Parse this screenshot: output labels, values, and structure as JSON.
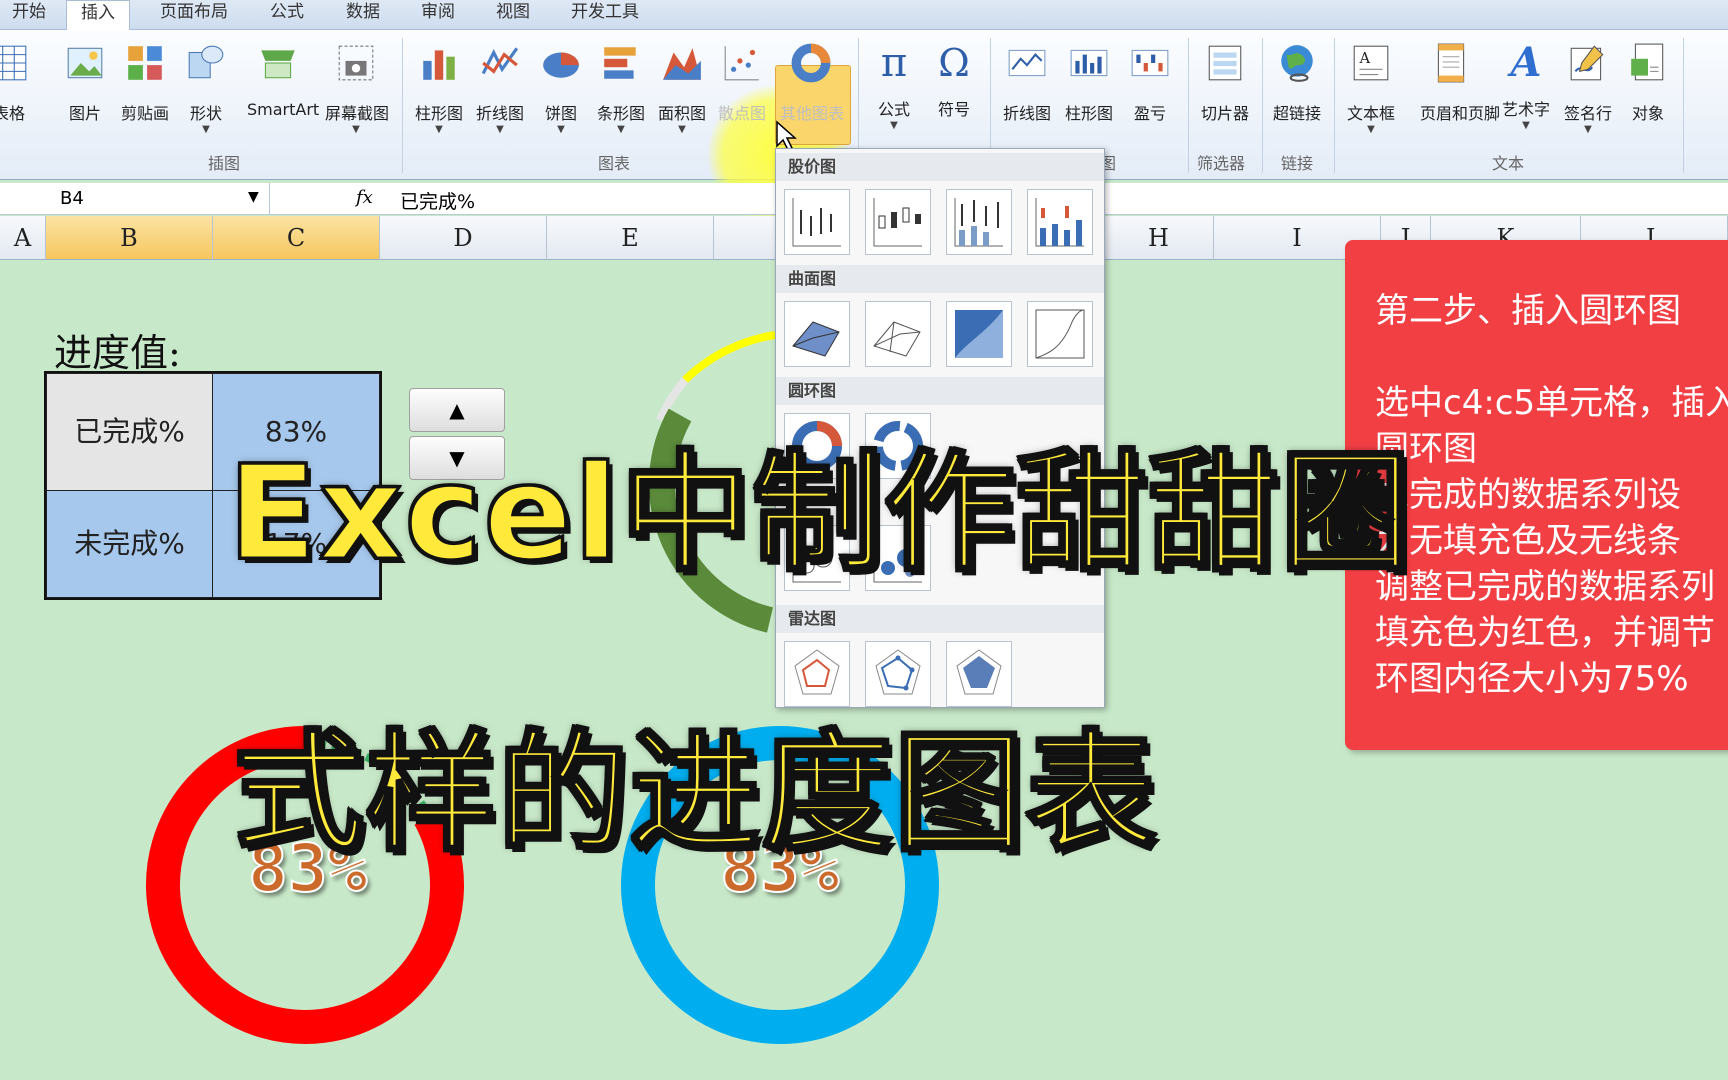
{
  "tabs": [
    "开始",
    "插入",
    "页面布局",
    "公式",
    "数据",
    "审阅",
    "视图",
    "开发工具"
  ],
  "ribbon": {
    "buttons": [
      "表格",
      "图片",
      "剪贴画",
      "形状",
      "SmartArt",
      "屏幕截图",
      "柱形图",
      "折线图",
      "饼图",
      "条形图",
      "面积图",
      "散点图",
      "其他图表",
      "公式",
      "符号",
      "折线图",
      "柱形图",
      "盈亏",
      "切片器",
      "超链接",
      "文本框",
      "页眉和页脚",
      "艺术字",
      "签名行",
      "对象"
    ],
    "groups": [
      "插图",
      "图表",
      "图",
      "筛选器",
      "链接",
      "文本"
    ]
  },
  "formula_bar": {
    "name_box": "B4",
    "fx": "fx",
    "content": "已完成%"
  },
  "columns": [
    "A",
    "B",
    "C",
    "D",
    "E",
    "H",
    "I",
    "J",
    "K",
    "L"
  ],
  "sheet": {
    "progress_label": "进度值:",
    "rows": [
      {
        "label": "已完成%",
        "value": "83%"
      },
      {
        "label": "未完成%",
        "value": "17%"
      }
    ],
    "spin_up": "▲",
    "spin_down": "▼"
  },
  "dropdown": {
    "sections": [
      "股价图",
      "曲面图",
      "圆环图",
      "雷达图"
    ]
  },
  "note": {
    "lines": [
      "第二步、插入圆环图",
      "",
      "选中c4:c5单元格，插入",
      "圆环图",
      "未完成的数据系列设",
      "为无填充色及无线条",
      "调整已完成的数据系列",
      "填充色为红色，并调节",
      "环图内径大小为75%"
    ]
  },
  "overlay": {
    "line1": "Excel中制作甜甜圈",
    "line2": "式样的进度图表"
  },
  "charts": [
    {
      "value_label": "83%",
      "color": "#ff0000",
      "value": 0.83
    },
    {
      "value_label": "83%",
      "color": "#00aeef",
      "value": 0.83
    }
  ],
  "colors": {
    "background": "#c8e9c9",
    "note": "#f13f44",
    "title": "#ffe93b",
    "selected_cell": "#a6c8ec"
  }
}
